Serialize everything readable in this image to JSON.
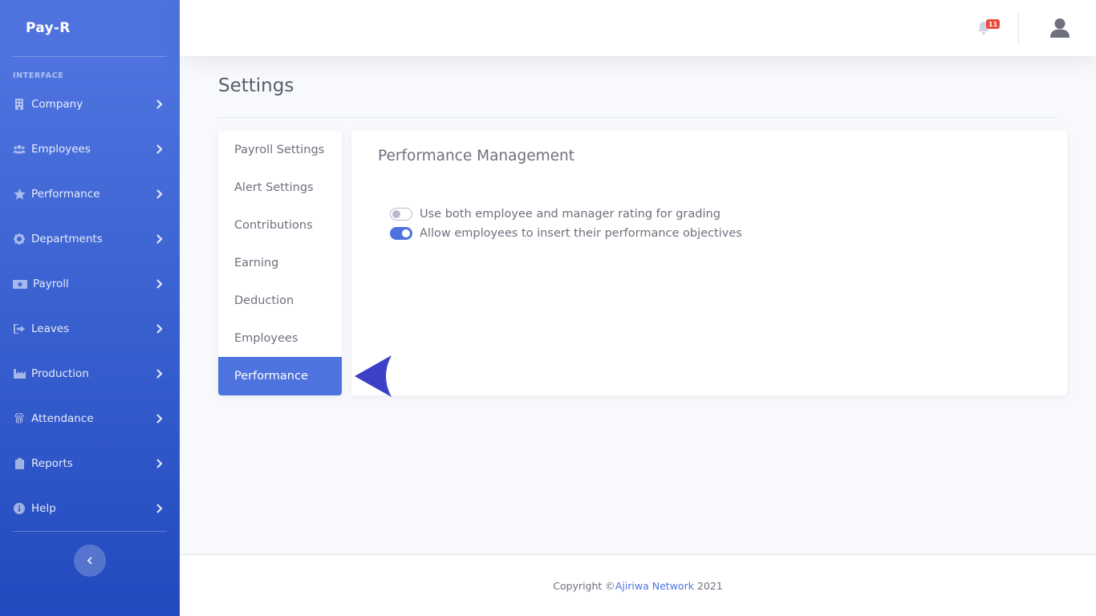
{
  "brand": {
    "name": "Pay-R"
  },
  "sidebar": {
    "heading": "INTERFACE",
    "items": [
      {
        "label": "Company",
        "icon": "building-icon"
      },
      {
        "label": "Employees",
        "icon": "users-icon"
      },
      {
        "label": "Performance",
        "icon": "star-icon"
      },
      {
        "label": "Departments",
        "icon": "cog-icon"
      },
      {
        "label": "Payroll",
        "icon": "money-icon"
      },
      {
        "label": "Leaves",
        "icon": "sign-out-icon"
      },
      {
        "label": "Production",
        "icon": "industry-icon"
      },
      {
        "label": "Attendance",
        "icon": "fingerprint-icon"
      },
      {
        "label": "Reports",
        "icon": "clipboard-icon"
      },
      {
        "label": "Help",
        "icon": "info-icon"
      }
    ]
  },
  "topbar": {
    "notification_count": "11"
  },
  "page": {
    "title": "Settings"
  },
  "settings_nav": {
    "items": [
      {
        "label": "Payroll Settings",
        "active": false
      },
      {
        "label": "Alert Settings",
        "active": false
      },
      {
        "label": "Contributions",
        "active": false
      },
      {
        "label": "Earning",
        "active": false
      },
      {
        "label": "Deduction",
        "active": false
      },
      {
        "label": "Employees",
        "active": false
      },
      {
        "label": "Performance",
        "active": true
      }
    ]
  },
  "panel": {
    "title": "Performance Management",
    "options": [
      {
        "label": "Use both employee and manager rating for grading",
        "enabled": false
      },
      {
        "label": "Allow employees to insert their performance objectives",
        "enabled": true
      }
    ]
  },
  "footer": {
    "prefix": "Copyright © ",
    "company": "Ajiriwa Network",
    "year": " 2021"
  },
  "colors": {
    "primary": "#4e73df",
    "sidebar_gradient_end": "#224abe",
    "badge": "#e74a3b",
    "pointer_arrow": "#3d3fc7"
  }
}
